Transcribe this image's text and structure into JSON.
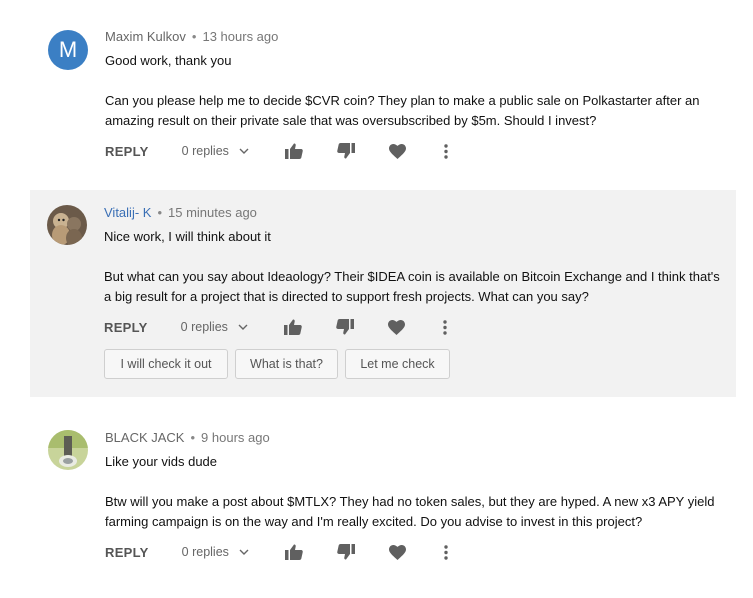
{
  "comments": [
    {
      "author": "Maxim Kulkov",
      "time": "13 hours ago",
      "avatar_letter": "M",
      "line1": "Good work, thank you",
      "line2": "Can you please help me to decide $CVR coin? They plan to make a public sale on Polkastarter after an",
      "line3": "amazing result on their private sale that was oversubscribed by $5m. Should I invest?",
      "reply_label": "REPLY",
      "replies_label": "0 replies"
    },
    {
      "author": "Vitalij- K",
      "time": "15 minutes ago",
      "line1": "Nice work, I will think about it",
      "line2": "But what can you say about Ideaology? Their $IDEA coin is available on Bitcoin Exchange and I think that's",
      "line3": "a big result for a project that is directed to support fresh projects. What can you say?",
      "reply_label": "REPLY",
      "replies_label": "0 replies",
      "suggestions": [
        "I will check it out",
        "What is that?",
        "Let me check"
      ]
    },
    {
      "author": "BLACK JACK",
      "time": "9 hours ago",
      "line1": "Like your vids dude",
      "line2": "Btw will you make a post about $MTLX? They had no token sales, but they are hyped. A new x3 APY yield",
      "line3": "farming campaign is on the way and I'm really excited. Do you advise to invest in this project?",
      "reply_label": "REPLY",
      "replies_label": "0 replies"
    }
  ],
  "colors": {
    "avatar_blue": "#3b7fc4",
    "highlight_bg": "#f2f2f2",
    "author_link": "#3a6fb5",
    "icon_gray": "#606060"
  },
  "icons": {
    "like": "thumbs-up-icon",
    "dislike": "thumbs-down-icon",
    "heart": "heart-icon",
    "more": "more-vertical-icon",
    "expand": "chevron-down-icon"
  }
}
